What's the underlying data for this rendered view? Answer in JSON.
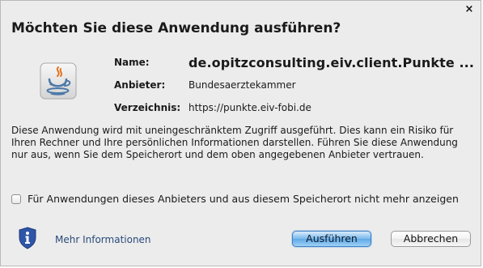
{
  "dialog": {
    "title": "Möchten Sie diese Anwendung ausführen?",
    "close_symbol": "×"
  },
  "info": {
    "name_label": "Name:",
    "name_value": "de.opitzconsulting.eiv.client.Punkte ...",
    "publisher_label": "Anbieter:",
    "publisher_value": "Bundesaerztekammer",
    "location_label": "Verzeichnis:",
    "location_value": "https://punkte.eiv-fobi.de"
  },
  "description": "Diese Anwendung wird mit uneingeschränktem Zugriff ausgeführt. Dies kann ein Risiko für Ihren Rechner und Ihre persönlichen Informationen darstellen. Führen Sie diese Anwendung nur aus, wenn Sie dem Speicherort und dem oben angegebenen Anbieter vertrauen.",
  "checkbox": {
    "label": "Für Anwendungen dieses Anbieters und aus diesem Speicherort nicht mehr anzeigen",
    "checked": false
  },
  "footer": {
    "more_info_label": "Mehr Informationen",
    "run_button": "Ausführen",
    "cancel_button": "Abbrechen"
  },
  "icons": {
    "app": "java-cup-icon",
    "info": "shield-info-icon",
    "close": "close-icon"
  },
  "colors": {
    "primary_button": "#79b8ec",
    "link": "#2a4a7a",
    "dialog_background": "#ececec",
    "shield": "#2f55a8"
  }
}
